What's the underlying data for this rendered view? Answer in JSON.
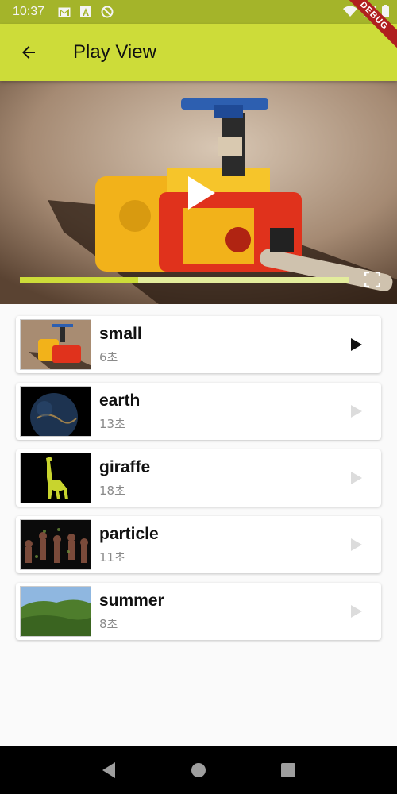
{
  "status_bar": {
    "time": "10:37",
    "left_icons": [
      "gmail-icon",
      "a-badge-icon",
      "no-data-icon"
    ],
    "right_icons": [
      "wifi-icon",
      "signal-icon",
      "battery-icon"
    ]
  },
  "debug_banner": "DEBUG",
  "app_bar": {
    "title": "Play View",
    "back_icon": "arrow-back-icon",
    "color": "#cddc39"
  },
  "player": {
    "progress": 0.36,
    "play_icon": "play-icon",
    "fullscreen_icon": "fullscreen-icon"
  },
  "videos": [
    {
      "title": "small",
      "duration": "6초",
      "playing": true
    },
    {
      "title": "earth",
      "duration": "13초",
      "playing": false
    },
    {
      "title": "giraffe",
      "duration": "18초",
      "playing": false
    },
    {
      "title": "particle",
      "duration": "11초",
      "playing": false
    },
    {
      "title": "summer",
      "duration": "8초",
      "playing": false
    }
  ],
  "nav": [
    "back-triangle-icon",
    "home-circle-icon",
    "recents-square-icon"
  ]
}
